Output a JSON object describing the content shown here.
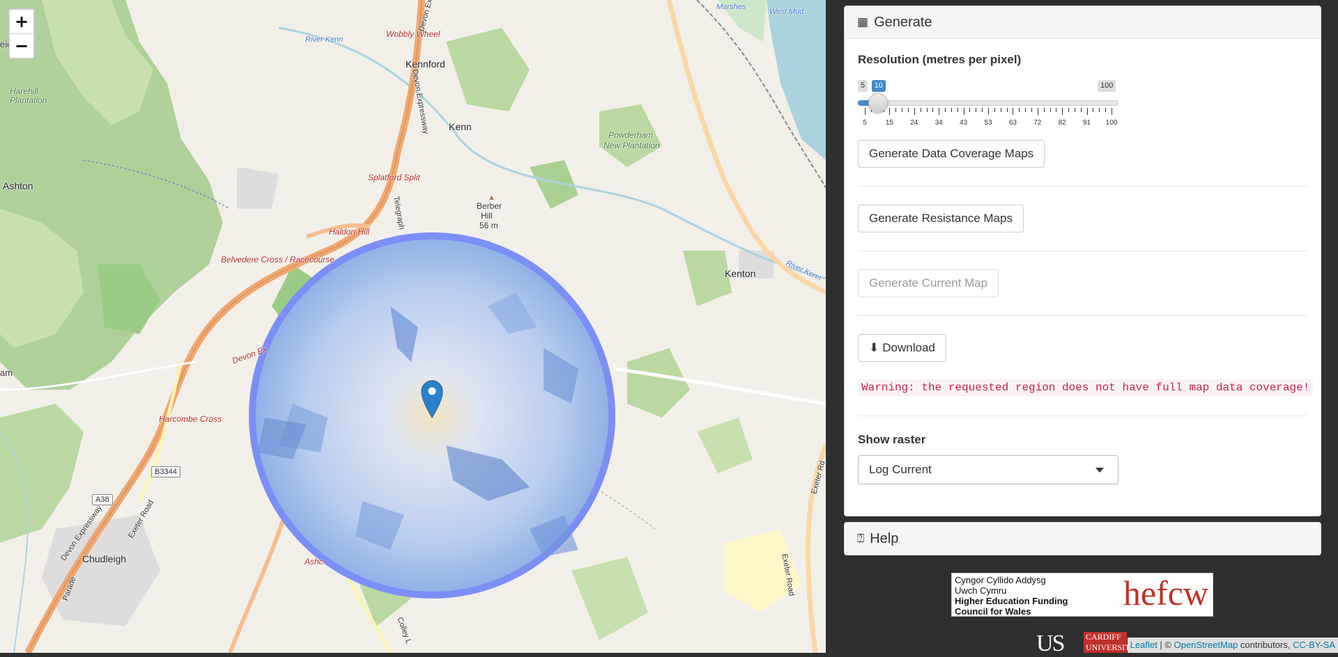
{
  "map": {
    "zoom_in_label": "+",
    "zoom_out_label": "−",
    "labels": {
      "marshes": "Marshes",
      "west_mud": "West Mud",
      "wobbly_wheel": "Wobbly Wheel",
      "river_kenn": "River Kenn",
      "kennford": "Kennford",
      "harehill": "Harehill",
      "plantation": "Plantation",
      "kenn": "Kenn",
      "powderham": "Powderham",
      "new_plantation": "New Plantation",
      "ashton": "Ashton",
      "splatford_split": "Splatford Split",
      "berber_hill": "Berber",
      "berber_hill2": "Hill",
      "berber_alt": "56 m",
      "haldon_hill": "Haldon Hill",
      "belvedere": "Belvedere Cross / Racecourse",
      "kenton": "Kenton",
      "river_kenn2": "River Kenn",
      "devon_exp": "Devon Ex",
      "harcombe": "Harcombe Cross",
      "b3344": "B3344",
      "a38": "A38",
      "chudleigh": "Chudleigh",
      "ashc": "Ashc",
      "am": "am",
      "elg": "eig",
      "exeter_road": "Exeter Road",
      "devon_expressway": "Devon Expressway",
      "parade": "Parade",
      "telegraph": "Telegraph",
      "devon_exp_top": "Devon Ex",
      "devon_expressway2": "Devon Expressway",
      "exeter_rd2": "Exeter Rd",
      "exeter_road3": "Exeter Road",
      "colley": "Colley L"
    },
    "attribution": {
      "leaflet": "Leaflet",
      "sep": " | © ",
      "osm": "OpenStreetMap",
      "contrib": " contributors, ",
      "license": "CC-BY-SA"
    }
  },
  "generate_panel": {
    "title": "Generate",
    "title_icon": "table-icon",
    "resolution_label": "Resolution (metres per pixel)",
    "slider": {
      "min": 5,
      "max": 100,
      "value": 10,
      "min_label": "5",
      "max_label": "100",
      "value_label": "10",
      "tick_labels": [
        "5",
        "15",
        "24",
        "34",
        "43",
        "53",
        "63",
        "72",
        "82",
        "91",
        "100"
      ]
    },
    "buttons": {
      "coverage": "Generate Data Coverage Maps",
      "resistance": "Generate Resistance Maps",
      "current": "Generate Current Map",
      "download": "Download"
    },
    "warning": "Warning: the requested region does not have full map data coverage!",
    "show_raster_label": "Show raster",
    "raster_select_value": "Log Current"
  },
  "help_panel": {
    "title": "Help",
    "title_icon": "question-icon"
  },
  "logos": {
    "hefcw_line1": "Cyngor Cyllido Addysg",
    "hefcw_line2": "Uwch Cymru",
    "hefcw_line3": "Higher Education Funding",
    "hefcw_line4": "Council for Wales",
    "hefcw_mark": "hefcw",
    "us_mark": "US",
    "cardiff_mark": "CARDIFF UNIVERSITY"
  },
  "colors": {
    "accent": "#428bca",
    "warning_text": "#c7254e",
    "circle_stroke": "#6b7ff0",
    "marker": "#2a81cb"
  }
}
